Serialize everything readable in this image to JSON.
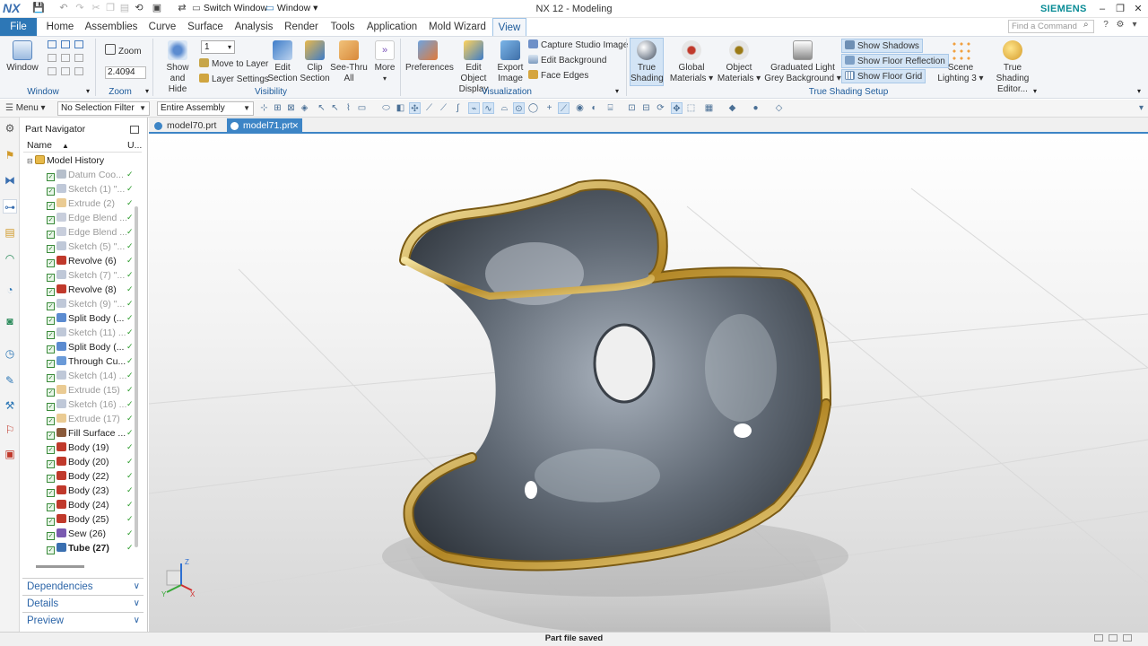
{
  "app": {
    "logo": "NX",
    "title": "NX 12 - Modeling",
    "brand": "SIEMENS"
  },
  "quick_access": {
    "switch_window": "Switch Window",
    "window": "Window ▾"
  },
  "menu_tabs": [
    "File",
    "Home",
    "Assemblies",
    "Curve",
    "Surface",
    "Analysis",
    "Render",
    "Tools",
    "Application",
    "Mold Wizard",
    "View"
  ],
  "active_tab": "View",
  "find_placeholder": "Find a Command",
  "ribbon": {
    "window_btn": "Window",
    "window_group": "Window",
    "zoom_label": "Zoom",
    "zoom_value": "2.4094",
    "zoom_group": "Zoom",
    "layer_value": "1",
    "show_hide": [
      "Show",
      "and Hide"
    ],
    "move_to_layer": "Move to Layer",
    "layer_settings": "Layer Settings",
    "edit_section": [
      "Edit",
      "Section"
    ],
    "clip_section": [
      "Clip",
      "Section"
    ],
    "see_thru": [
      "See-Thru",
      "All"
    ],
    "more": "More",
    "visibility_group": "Visibility",
    "preferences": "Preferences",
    "edit_object_display": [
      "Edit Object",
      "Display"
    ],
    "export_image": [
      "Export",
      "Image"
    ],
    "capture_studio": "Capture Studio Image",
    "edit_background": "Edit Background",
    "face_edges": "Face Edges",
    "visualization_group": "Visualization",
    "true_shading": [
      "True",
      "Shading"
    ],
    "global_materials": [
      "Global",
      "Materials ▾"
    ],
    "object_materials": [
      "Object",
      "Materials ▾"
    ],
    "graduated_light": [
      "Graduated Light",
      "Grey Background ▾"
    ],
    "show_shadows": "Show Shadows",
    "show_floor_reflection": "Show Floor Reflection",
    "show_floor_grid": "Show Floor Grid",
    "scene_lighting": [
      "Scene",
      "Lighting 3 ▾"
    ],
    "true_shading_editor": [
      "True Shading",
      "Editor..."
    ],
    "true_shading_setup_group": "True Shading Setup"
  },
  "toolbar2": {
    "menu": "Menu ▾",
    "selection_filter": "No Selection Filter",
    "scope": "Entire Assembly"
  },
  "doc_tabs": [
    {
      "label": "model70.prt",
      "active": false
    },
    {
      "label": "model71.prt",
      "active": true
    }
  ],
  "doc_tab_close": "✕",
  "navigator": {
    "title": "Part Navigator",
    "col_name": "Name",
    "col_u": "U...",
    "root": "Model History",
    "items": [
      {
        "label": "Datum Coo...",
        "state": "dim",
        "icon": "datum"
      },
      {
        "label": "Sketch (1) \"...",
        "state": "dim",
        "icon": "sketch"
      },
      {
        "label": "Extrude (2)",
        "state": "dim",
        "icon": "extrude"
      },
      {
        "label": "Edge Blend ...",
        "state": "dim",
        "icon": "blend"
      },
      {
        "label": "Edge Blend ...",
        "state": "dim",
        "icon": "blend"
      },
      {
        "label": "Sketch (5) \"...",
        "state": "dim",
        "icon": "sketch"
      },
      {
        "label": "Revolve (6)",
        "state": "normal",
        "icon": "revolve"
      },
      {
        "label": "Sketch (7) \"...",
        "state": "dim",
        "icon": "sketch"
      },
      {
        "label": "Revolve (8)",
        "state": "normal",
        "icon": "revolve"
      },
      {
        "label": "Sketch (9) \"...",
        "state": "dim",
        "icon": "sketch"
      },
      {
        "label": "Split Body (...",
        "state": "normal",
        "icon": "split"
      },
      {
        "label": "Sketch (11) ...",
        "state": "dim",
        "icon": "sketch"
      },
      {
        "label": "Split Body (...",
        "state": "normal",
        "icon": "split"
      },
      {
        "label": "Through Cu...",
        "state": "normal",
        "icon": "through"
      },
      {
        "label": "Sketch (14) ...",
        "state": "dim",
        "icon": "sketch"
      },
      {
        "label": "Extrude (15)",
        "state": "dim",
        "icon": "extrude"
      },
      {
        "label": "Sketch (16) ...",
        "state": "dim",
        "icon": "sketch"
      },
      {
        "label": "Extrude (17)",
        "state": "dim",
        "icon": "extrude"
      },
      {
        "label": "Fill Surface ...",
        "state": "normal",
        "icon": "fill"
      },
      {
        "label": "Body (19)",
        "state": "normal",
        "icon": "body"
      },
      {
        "label": "Body (20)",
        "state": "normal",
        "icon": "body"
      },
      {
        "label": "Body (22)",
        "state": "normal",
        "icon": "body"
      },
      {
        "label": "Body (23)",
        "state": "normal",
        "icon": "body"
      },
      {
        "label": "Body (24)",
        "state": "normal",
        "icon": "body"
      },
      {
        "label": "Body (25)",
        "state": "normal",
        "icon": "body"
      },
      {
        "label": "Sew (26)",
        "state": "normal",
        "icon": "sew"
      },
      {
        "label": "Tube (27)",
        "state": "bold",
        "icon": "tube"
      }
    ],
    "panels": [
      "Dependencies",
      "Details",
      "Preview"
    ]
  },
  "triad": {
    "z": "Z",
    "y": "Y",
    "x": "X"
  },
  "status": "Part file saved"
}
